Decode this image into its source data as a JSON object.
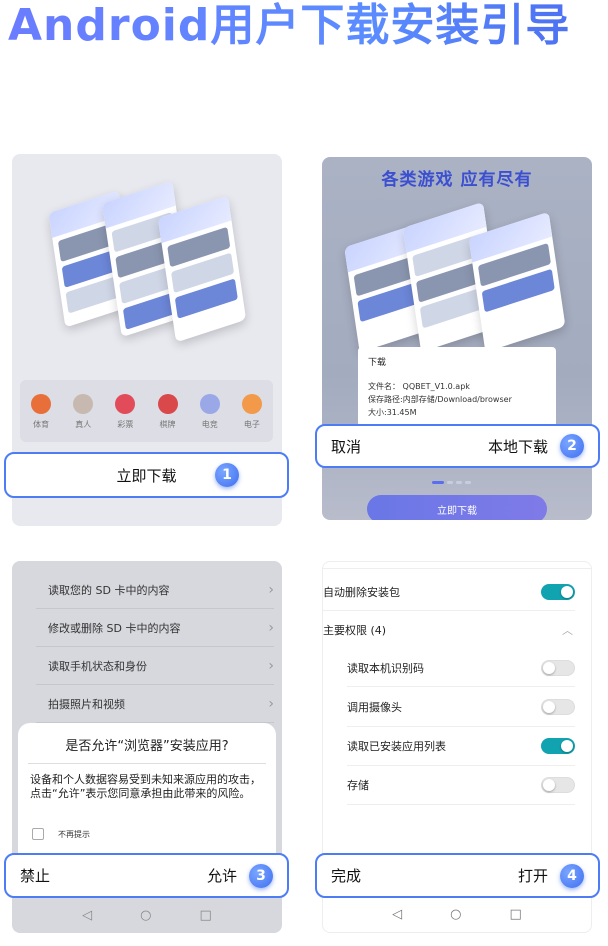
{
  "title": "Android用户下载安装引导",
  "step1": {
    "games": [
      {
        "label": "体育",
        "icon": "sports-icon",
        "color": "#e86f3a"
      },
      {
        "label": "真人",
        "icon": "live-casino-icon",
        "color": "#c7b9b0"
      },
      {
        "label": "彩票",
        "icon": "lottery-icon",
        "color": "#e24b5a"
      },
      {
        "label": "棋牌",
        "icon": "cards-icon",
        "color": "#d9484a"
      },
      {
        "label": "电竞",
        "icon": "gamepad-icon",
        "color": "#9aa8e8"
      },
      {
        "label": "电子",
        "icon": "slots-icon",
        "color": "#f2994a"
      }
    ],
    "action_label": "立即下载",
    "badge": "1"
  },
  "step2": {
    "heading": "各类游戏 应有尽有",
    "dialog_title": "下载",
    "file_name": "文件名： QQBET_V1.0.apk",
    "save_path": "保存路径:内部存储/Download/browser",
    "size": "大小:31.45M",
    "bottom_button": "立即下载",
    "cancel_label": "取消",
    "confirm_label": "本地下载",
    "badge": "2"
  },
  "step3": {
    "permissions": [
      "读取您的 SD 卡中的内容",
      "修改或删除 SD 卡中的内容",
      "读取手机状态和身份",
      "拍摄照片和视频"
    ],
    "question": "是否允许“浏览器”安装应用?",
    "message": "设备和个人数据容易受到未知来源应用的攻击，点击“允许”表示您同意承担由此带来的风险。",
    "checkbox_label": "不再提示",
    "deny_label": "禁止",
    "allow_label": "允许",
    "badge": "3",
    "nav": {
      "back": "◁",
      "home": "○",
      "recent": "□"
    }
  },
  "step4": {
    "auto_delete": {
      "label": "自动删除安装包",
      "on": true
    },
    "section": "主要权限 (4)",
    "permissions": [
      {
        "label": "读取本机识别码",
        "on": false
      },
      {
        "label": "调用摄像头",
        "on": false
      },
      {
        "label": "读取已安装应用列表",
        "on": true
      },
      {
        "label": "存储",
        "on": false
      }
    ],
    "done_label": "完成",
    "open_label": "打开",
    "badge": "4",
    "nav": {
      "back": "◁",
      "home": "○",
      "recent": "□"
    }
  }
}
